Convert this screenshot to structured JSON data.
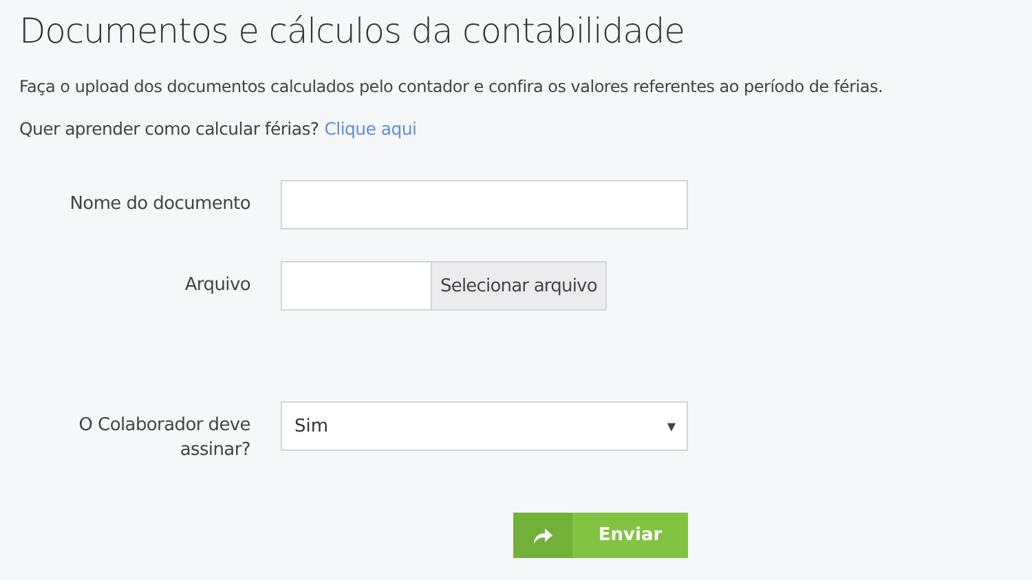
{
  "title": "Documentos e cálculos da contabilidade",
  "description": "Faça o upload dos documentos calculados pelo contador e confira os valores referentes ao período de férias.",
  "help": {
    "text": "Quer aprender como calcular férias?",
    "link": "Clique aqui"
  },
  "fields": [
    {
      "kind": "text",
      "label": "Nome do documento"
    },
    {
      "kind": "file",
      "label": "Arquivo",
      "button": "Selecionar arquivo"
    },
    {
      "kind": "select",
      "label": "O Colaborador deve assinar?",
      "value": "Sim",
      "arrow": "▼"
    }
  ],
  "submit": {
    "label": "Enviar"
  }
}
